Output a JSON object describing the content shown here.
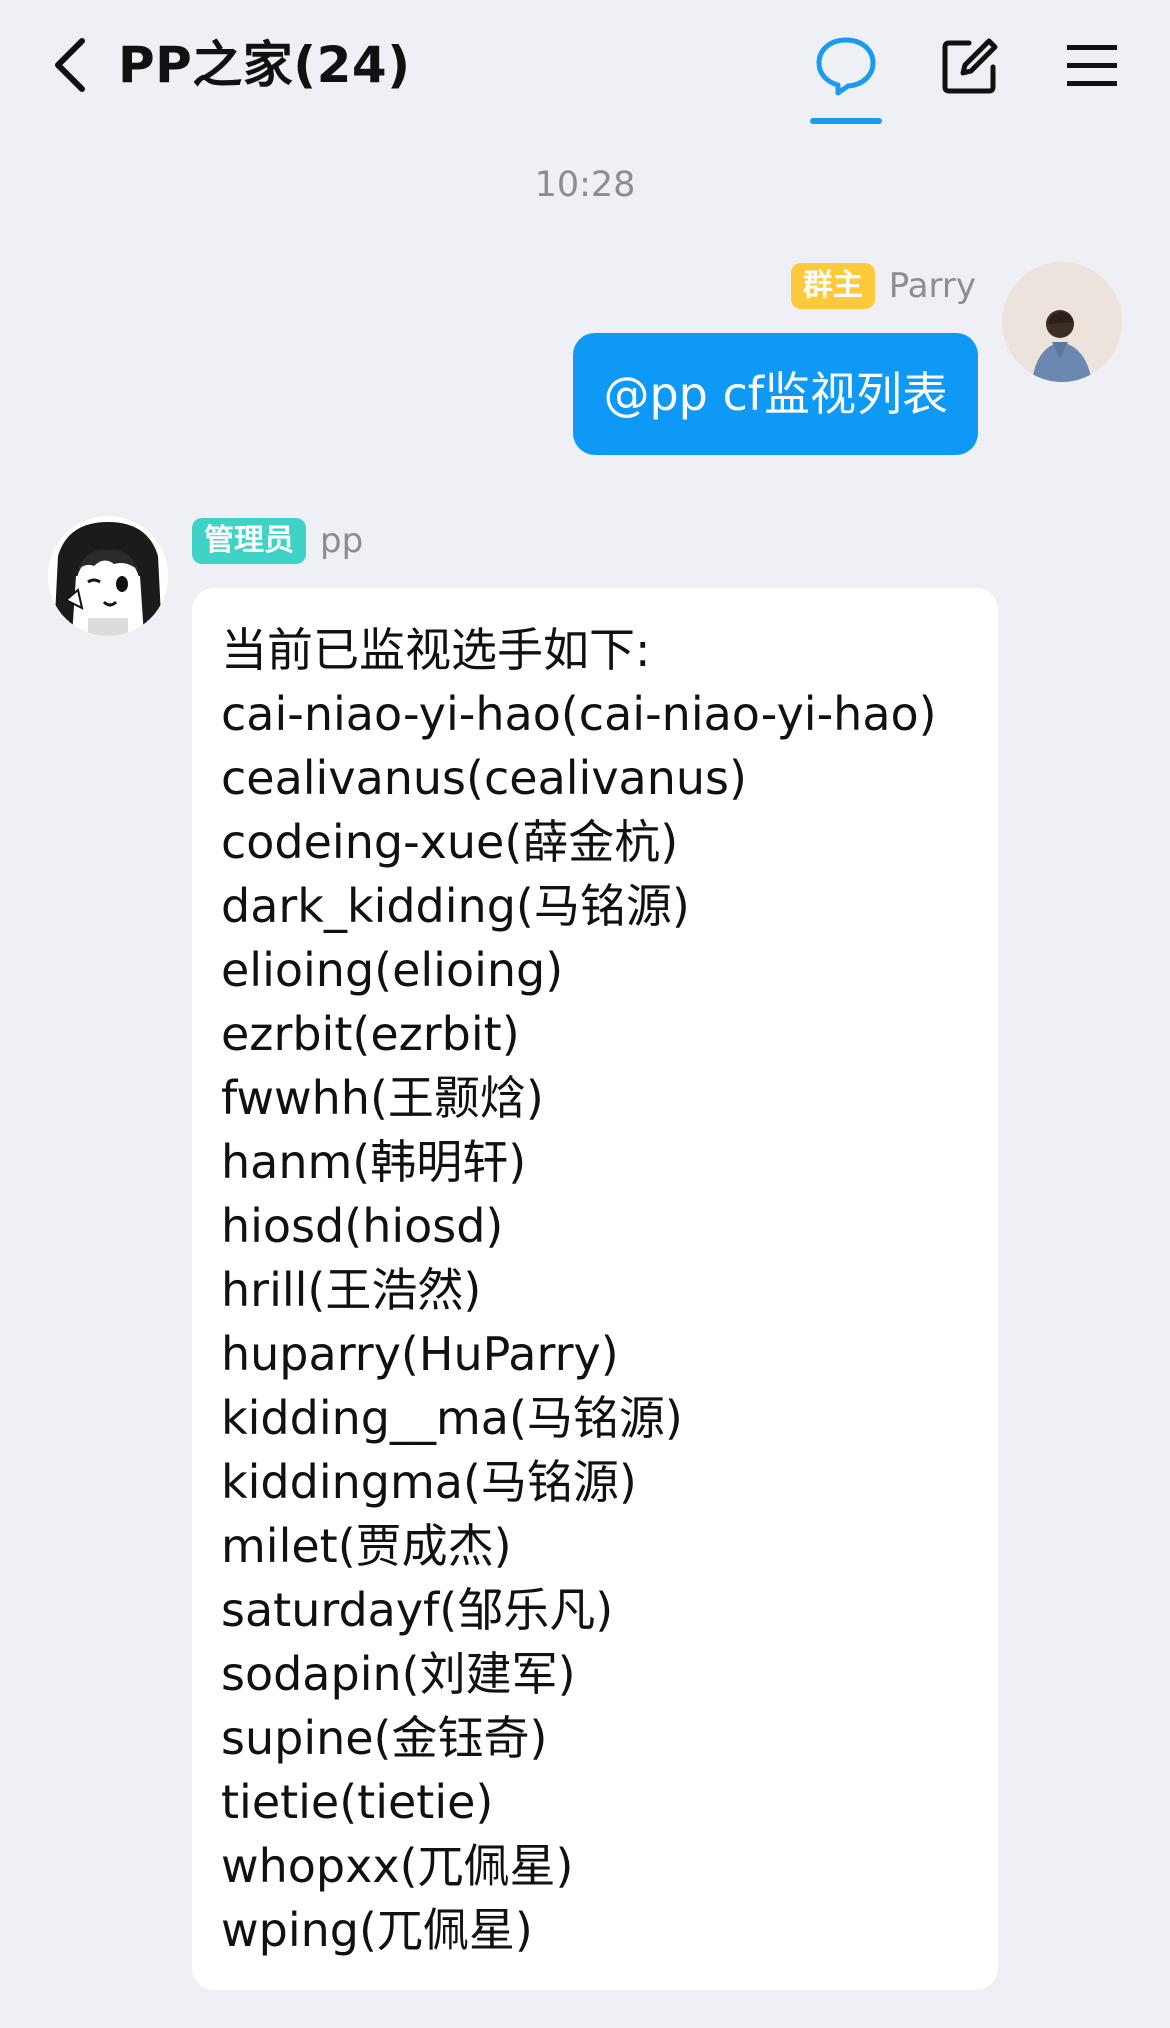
{
  "header": {
    "title": "PP之家(24)",
    "accent_color": "#1a9bf0",
    "icons": [
      "back-chevron-icon",
      "chat-bubble-icon",
      "edit-icon",
      "menu-icon"
    ]
  },
  "messages": {
    "timestamp": "10:28",
    "outgoing": {
      "badge": "群主",
      "sender": "Parry",
      "text": "@pp cf监视列表",
      "bubble_color": "#0e99f7"
    },
    "incoming": {
      "badge": "管理员",
      "sender": "pp",
      "lines": [
        "当前已监视选手如下:",
        "cai-niao-yi-hao(cai-niao-yi-hao)",
        "cealivanus(cealivanus)",
        "codeing-xue(薛金杭)",
        "dark_kidding(马铭源)",
        "elioing(elioing)",
        "ezrbit(ezrbit)",
        "fwwhh(王颢焓)",
        "hanm(韩明轩)",
        "hiosd(hiosd)",
        "hrill(王浩然)",
        "huparry(HuParry)",
        "kidding__ma(马铭源)",
        "kiddingma(马铭源)",
        "milet(贾成杰)",
        "saturdayf(邹乐凡)",
        "sodapin(刘建军)",
        "supine(金钰奇)",
        "tietie(tietie)",
        "whopxx(兀佩星)",
        "wping(兀佩星)"
      ]
    }
  }
}
